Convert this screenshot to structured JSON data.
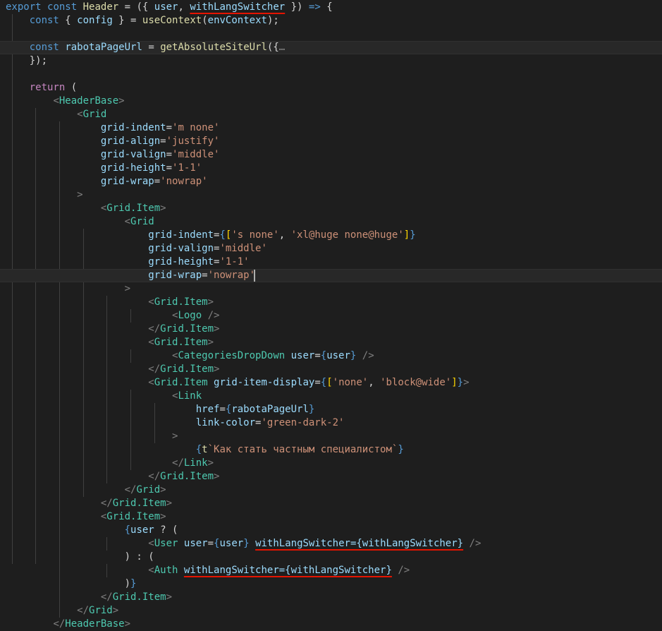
{
  "editor": {
    "lines": [
      [
        [
          "export",
          "kw"
        ],
        [
          " ",
          "pun"
        ],
        [
          "const",
          "kw"
        ],
        [
          " ",
          "pun"
        ],
        [
          "Header",
          "fn"
        ],
        [
          " = ({ ",
          "pun"
        ],
        [
          "user",
          "var"
        ],
        [
          ", ",
          "pun"
        ],
        [
          "withLangSwitcher",
          "var",
          true
        ],
        [
          " }) ",
          "pun"
        ],
        [
          "=>",
          "kw"
        ],
        [
          " {",
          "pun"
        ]
      ],
      [
        [
          "    ",
          "pun"
        ],
        [
          "const",
          "kw"
        ],
        [
          " { ",
          "pun"
        ],
        [
          "config",
          "var"
        ],
        [
          " } = ",
          "pun"
        ],
        [
          "useContext",
          "fn"
        ],
        [
          "(",
          "pun"
        ],
        [
          "envContext",
          "var"
        ],
        [
          ");",
          "pun"
        ]
      ],
      [],
      [
        [
          "    ",
          "pun"
        ],
        [
          "const",
          "kw"
        ],
        [
          " ",
          "pun"
        ],
        [
          "rabotaPageUrl",
          "var"
        ],
        [
          " = ",
          "pun"
        ],
        [
          "getAbsoluteSiteUrl",
          "fn"
        ],
        [
          "({",
          "pun"
        ],
        [
          "…",
          "fld"
        ]
      ],
      [
        [
          "    ",
          "pun"
        ],
        [
          "});",
          "pun"
        ]
      ],
      [],
      [
        [
          "    ",
          "pun"
        ],
        [
          "return",
          "ctl"
        ],
        [
          " (",
          "pun"
        ]
      ],
      [
        [
          "        ",
          "pun"
        ],
        [
          "<",
          "br"
        ],
        [
          "HeaderBase",
          "tag"
        ],
        [
          ">",
          "br"
        ]
      ],
      [
        [
          "            ",
          "pun"
        ],
        [
          "<",
          "br"
        ],
        [
          "Grid",
          "tag"
        ]
      ],
      [
        [
          "                ",
          "pun"
        ],
        [
          "grid-indent",
          "var"
        ],
        [
          "=",
          "pun"
        ],
        [
          "'m none'",
          "str"
        ]
      ],
      [
        [
          "                ",
          "pun"
        ],
        [
          "grid-align",
          "var"
        ],
        [
          "=",
          "pun"
        ],
        [
          "'justify'",
          "str"
        ]
      ],
      [
        [
          "                ",
          "pun"
        ],
        [
          "grid-valign",
          "var"
        ],
        [
          "=",
          "pun"
        ],
        [
          "'middle'",
          "str"
        ]
      ],
      [
        [
          "                ",
          "pun"
        ],
        [
          "grid-height",
          "var"
        ],
        [
          "=",
          "pun"
        ],
        [
          "'1-1'",
          "str"
        ]
      ],
      [
        [
          "                ",
          "pun"
        ],
        [
          "grid-wrap",
          "var"
        ],
        [
          "=",
          "pun"
        ],
        [
          "'nowrap'",
          "str"
        ]
      ],
      [
        [
          "            ",
          "pun"
        ],
        [
          ">",
          "br"
        ]
      ],
      [
        [
          "                ",
          "pun"
        ],
        [
          "<",
          "br"
        ],
        [
          "Grid.Item",
          "tag"
        ],
        [
          ">",
          "br"
        ]
      ],
      [
        [
          "                    ",
          "pun"
        ],
        [
          "<",
          "br"
        ],
        [
          "Grid",
          "tag"
        ]
      ],
      [
        [
          "                        ",
          "pun"
        ],
        [
          "grid-indent",
          "var"
        ],
        [
          "=",
          "pun"
        ],
        [
          "{",
          "kw"
        ],
        [
          "[",
          "gold"
        ],
        [
          "'s none'",
          "str"
        ],
        [
          ", ",
          "pun"
        ],
        [
          "'xl@huge none@huge'",
          "str"
        ],
        [
          "]",
          "gold"
        ],
        [
          "}",
          "kw"
        ]
      ],
      [
        [
          "                        ",
          "pun"
        ],
        [
          "grid-valign",
          "var"
        ],
        [
          "=",
          "pun"
        ],
        [
          "'middle'",
          "str"
        ]
      ],
      [
        [
          "                        ",
          "pun"
        ],
        [
          "grid-height",
          "var"
        ],
        [
          "=",
          "pun"
        ],
        [
          "'1-1'",
          "str"
        ]
      ],
      [
        [
          "                        ",
          "pun"
        ],
        [
          "grid-wrap",
          "var"
        ],
        [
          "=",
          "pun"
        ],
        [
          "'nowrap'",
          "str"
        ]
      ],
      [
        [
          "                    ",
          "pun"
        ],
        [
          ">",
          "br"
        ]
      ],
      [
        [
          "                        ",
          "pun"
        ],
        [
          "<",
          "br"
        ],
        [
          "Grid.Item",
          "tag"
        ],
        [
          ">",
          "br"
        ]
      ],
      [
        [
          "                            ",
          "pun"
        ],
        [
          "<",
          "br"
        ],
        [
          "Logo",
          "tag"
        ],
        [
          " />",
          "br"
        ]
      ],
      [
        [
          "                        ",
          "pun"
        ],
        [
          "</",
          "br"
        ],
        [
          "Grid.Item",
          "tag"
        ],
        [
          ">",
          "br"
        ]
      ],
      [
        [
          "                        ",
          "pun"
        ],
        [
          "<",
          "br"
        ],
        [
          "Grid.Item",
          "tag"
        ],
        [
          ">",
          "br"
        ]
      ],
      [
        [
          "                            ",
          "pun"
        ],
        [
          "<",
          "br"
        ],
        [
          "CategoriesDropDown",
          "tag"
        ],
        [
          " ",
          "pun"
        ],
        [
          "user",
          "var"
        ],
        [
          "=",
          "pun"
        ],
        [
          "{",
          "kw"
        ],
        [
          "user",
          "var"
        ],
        [
          "}",
          "kw"
        ],
        [
          " />",
          "br"
        ]
      ],
      [
        [
          "                        ",
          "pun"
        ],
        [
          "</",
          "br"
        ],
        [
          "Grid.Item",
          "tag"
        ],
        [
          ">",
          "br"
        ]
      ],
      [
        [
          "                        ",
          "pun"
        ],
        [
          "<",
          "br"
        ],
        [
          "Grid.Item",
          "tag"
        ],
        [
          " ",
          "pun"
        ],
        [
          "grid-item-display",
          "var"
        ],
        [
          "=",
          "pun"
        ],
        [
          "{",
          "kw"
        ],
        [
          "[",
          "gold"
        ],
        [
          "'none'",
          "str"
        ],
        [
          ", ",
          "pun"
        ],
        [
          "'block@wide'",
          "str"
        ],
        [
          "]",
          "gold"
        ],
        [
          "}",
          "kw"
        ],
        [
          ">",
          "br"
        ]
      ],
      [
        [
          "                            ",
          "pun"
        ],
        [
          "<",
          "br"
        ],
        [
          "Link",
          "tag"
        ]
      ],
      [
        [
          "                                ",
          "pun"
        ],
        [
          "href",
          "var"
        ],
        [
          "=",
          "pun"
        ],
        [
          "{",
          "kw"
        ],
        [
          "rabotaPageUrl",
          "var"
        ],
        [
          "}",
          "kw"
        ]
      ],
      [
        [
          "                                ",
          "pun"
        ],
        [
          "link-color",
          "var"
        ],
        [
          "=",
          "pun"
        ],
        [
          "'green-dark-2'",
          "str"
        ]
      ],
      [
        [
          "                            ",
          "pun"
        ],
        [
          ">",
          "br"
        ]
      ],
      [
        [
          "                                ",
          "pun"
        ],
        [
          "{",
          "kw"
        ],
        [
          "t",
          "fn"
        ],
        [
          "`Как стать частным специалистом`",
          "str"
        ],
        [
          "}",
          "kw"
        ]
      ],
      [
        [
          "                            ",
          "pun"
        ],
        [
          "</",
          "br"
        ],
        [
          "Link",
          "tag"
        ],
        [
          ">",
          "br"
        ]
      ],
      [
        [
          "                        ",
          "pun"
        ],
        [
          "</",
          "br"
        ],
        [
          "Grid.Item",
          "tag"
        ],
        [
          ">",
          "br"
        ]
      ],
      [
        [
          "                    ",
          "pun"
        ],
        [
          "</",
          "br"
        ],
        [
          "Grid",
          "tag"
        ],
        [
          ">",
          "br"
        ]
      ],
      [
        [
          "                ",
          "pun"
        ],
        [
          "</",
          "br"
        ],
        [
          "Grid.Item",
          "tag"
        ],
        [
          ">",
          "br"
        ]
      ],
      [
        [
          "                ",
          "pun"
        ],
        [
          "<",
          "br"
        ],
        [
          "Grid.Item",
          "tag"
        ],
        [
          ">",
          "br"
        ]
      ],
      [
        [
          "                    ",
          "pun"
        ],
        [
          "{",
          "kw"
        ],
        [
          "user",
          "var"
        ],
        [
          " ? (",
          "pun"
        ]
      ],
      [
        [
          "                        ",
          "pun"
        ],
        [
          "<",
          "br"
        ],
        [
          "User",
          "tag"
        ],
        [
          " ",
          "pun"
        ],
        [
          "user",
          "var"
        ],
        [
          "=",
          "pun"
        ],
        [
          "{",
          "kw"
        ],
        [
          "user",
          "var"
        ],
        [
          "}",
          "kw"
        ],
        [
          " ",
          "pun"
        ],
        [
          "withLangSwitcher={withLangSwitcher}",
          "var",
          true
        ],
        [
          " />",
          "br"
        ]
      ],
      [
        [
          "                    ",
          "pun"
        ],
        [
          ") : (",
          "pun"
        ]
      ],
      [
        [
          "                        ",
          "pun"
        ],
        [
          "<",
          "br"
        ],
        [
          "Auth",
          "tag"
        ],
        [
          " ",
          "pun"
        ],
        [
          "withLangSwitcher={withLangSwitcher}",
          "var",
          true
        ],
        [
          " />",
          "br"
        ]
      ],
      [
        [
          "                    ",
          "pun"
        ],
        [
          ")",
          "pun"
        ],
        [
          "}",
          "kw"
        ]
      ],
      [
        [
          "                ",
          "pun"
        ],
        [
          "</",
          "br"
        ],
        [
          "Grid.Item",
          "tag"
        ],
        [
          ">",
          "br"
        ]
      ],
      [
        [
          "            ",
          "pun"
        ],
        [
          "</",
          "br"
        ],
        [
          "Grid",
          "tag"
        ],
        [
          ">",
          "br"
        ]
      ],
      [
        [
          "        ",
          "pun"
        ],
        [
          "</",
          "br"
        ],
        [
          "HeaderBase",
          "tag"
        ],
        [
          ">",
          "br"
        ]
      ]
    ]
  }
}
